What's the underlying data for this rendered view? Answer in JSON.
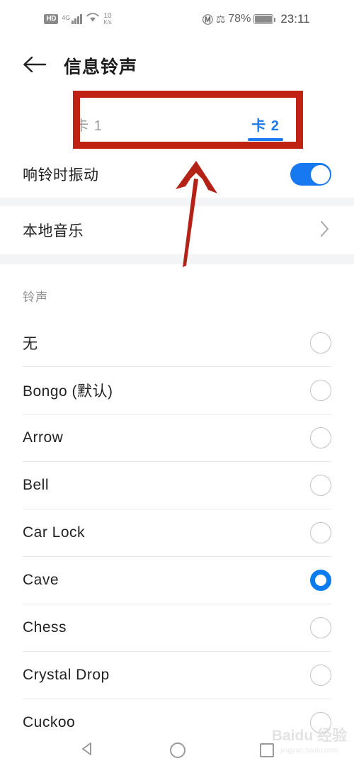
{
  "status_bar": {
    "hd_label": "HD",
    "network_type": "4G",
    "data_rate_value": "10",
    "data_rate_unit": "K/s",
    "nfc_icon": "nfc-icon",
    "bluetooth_icon": "bluetooth-icon",
    "battery_percent": "78%",
    "time": "23:11"
  },
  "header": {
    "back_icon": "back-arrow-icon",
    "title": "信息铃声"
  },
  "tabs": [
    {
      "label": "卡 1",
      "active": false
    },
    {
      "label": "卡 2",
      "active": true
    }
  ],
  "settings": {
    "vibrate_label": "响铃时振动",
    "vibrate_on": true,
    "local_music_label": "本地音乐",
    "chevron_icon": "chevron-right-icon"
  },
  "section": {
    "ringtone_header": "铃声"
  },
  "ringtones": [
    {
      "label": "无",
      "selected": false
    },
    {
      "label": "Bongo (默认)",
      "selected": false
    },
    {
      "label": "Arrow",
      "selected": false
    },
    {
      "label": "Bell",
      "selected": false
    },
    {
      "label": "Car Lock",
      "selected": false
    },
    {
      "label": "Cave",
      "selected": true
    },
    {
      "label": "Chess",
      "selected": false
    },
    {
      "label": "Crystal Drop",
      "selected": false
    },
    {
      "label": "Cuckoo",
      "selected": false
    }
  ],
  "annotations": {
    "highlight_color": "#bf2113",
    "arrow_color": "#b32117",
    "highlight_target": "卡 2",
    "arrow_target": "卡 2"
  },
  "navigation": {
    "back_icon": "nav-back-triangle-icon",
    "home_icon": "nav-home-circle-icon",
    "recents_icon": "nav-recents-square-icon"
  },
  "watermark": {
    "text": "Baidu 经验",
    "sub": "jingyan.baidu.com"
  },
  "theme": {
    "accent": "#1878f0",
    "text": "#222222",
    "muted": "#8d8d8d",
    "divider": "#e8e8e8",
    "band": "#f3f4f6"
  }
}
